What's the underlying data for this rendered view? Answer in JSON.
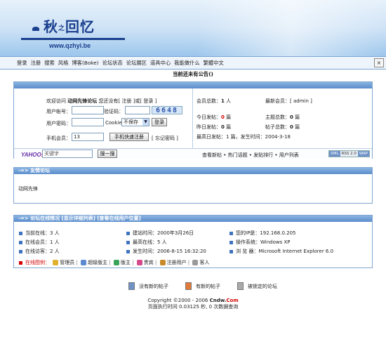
{
  "logo": {
    "title_main": "秋",
    "title_small": "之",
    "title_rest": "回忆",
    "url": "www.qzhyi.be"
  },
  "nav": {
    "items": [
      "登录",
      "注册",
      "搜索",
      "风格",
      "博客(Boke)",
      "论坛状态",
      "论坛展区",
      "道具中心",
      "我能做什么",
      "繁體中文"
    ],
    "close_glyph": "×"
  },
  "notice": "当前还未有公告()",
  "login": {
    "welcome_prefix": "欢迎访问",
    "forum_name": "动网先锋论坛",
    "welcome_mid": "您还没有",
    "register_link": "[ 注册 ]",
    "or": "或",
    "login_link": "[ 登录 ]",
    "account_label": "用户帐号：",
    "captcha_label": "验证码：",
    "captcha_code": "6648",
    "password_label": "用户密码：",
    "cookie_label": "Cookie",
    "cookie_option": "不保存",
    "login_button": "登录",
    "mobile_label": "手机会员：",
    "mobile_value": "13",
    "quick_register_button": "手机快速注册",
    "forgot_password": "[ 忘记密码 ]"
  },
  "stats": {
    "members_label": "会员总数：",
    "members_value": "1",
    "members_unit": "人",
    "newest_label": "最新会员：",
    "newest_value": "[ admin ]",
    "today_label": "今日发帖：",
    "today_value": "0",
    "today_unit": "篇",
    "topics_label": "主题总数：",
    "topics_value": "0",
    "topics_unit": "篇",
    "yesterday_label": "昨日发帖：",
    "yesterday_value": "0",
    "yesterday_unit": "篇",
    "posts_label": "帖子总数：",
    "posts_value": "0",
    "posts_unit": "篇",
    "peak_text": "最高日发帖：1 篇，发生时间：2004-3-18"
  },
  "search": {
    "yahoo_text": "YAHOO",
    "yahoo_mark": "!",
    "keyword_placeholder": "关键字",
    "search_button": "搜一搜",
    "links": "查看新帖 • 热门话题 • 发贴排行 • 用户列表",
    "rss": [
      "XML",
      "RSS 2.0",
      "WAP"
    ]
  },
  "friends": {
    "header": "-=> 友情论坛",
    "link": "动网先锋"
  },
  "online": {
    "header": "-=> 论坛在线情况 [显示详细列表] [查看在线用户位置]",
    "rows": [
      [
        "当前在线：3 人",
        "建站时间：2000年3月26日",
        "您的IP是：192.168.0.205"
      ],
      [
        "在线会员：1 人",
        "最高在线：5 人",
        "操作系统：Windows XP"
      ],
      [
        "在线访客：2 人",
        "发生时间：2006-8-15 16:32:20",
        "浏 览 器：Microsoft Internet Explorer 6.0"
      ]
    ],
    "legend_label": "在线图例：",
    "legend_items": [
      "管理员",
      "超级版主",
      "版主",
      "贵宾",
      "注册用户",
      "客人"
    ]
  },
  "status_icons": [
    "没有新的帖子",
    "有新的帖子",
    "被锁定的论坛"
  ],
  "footer": {
    "copyright": "Copyright ©2000 - 2006",
    "brand": "Cndw",
    "brand_dot": ".",
    "brand_com": "Com",
    "exec_time": "页面执行时间 0.03125 秒, 0 次数据查询"
  }
}
